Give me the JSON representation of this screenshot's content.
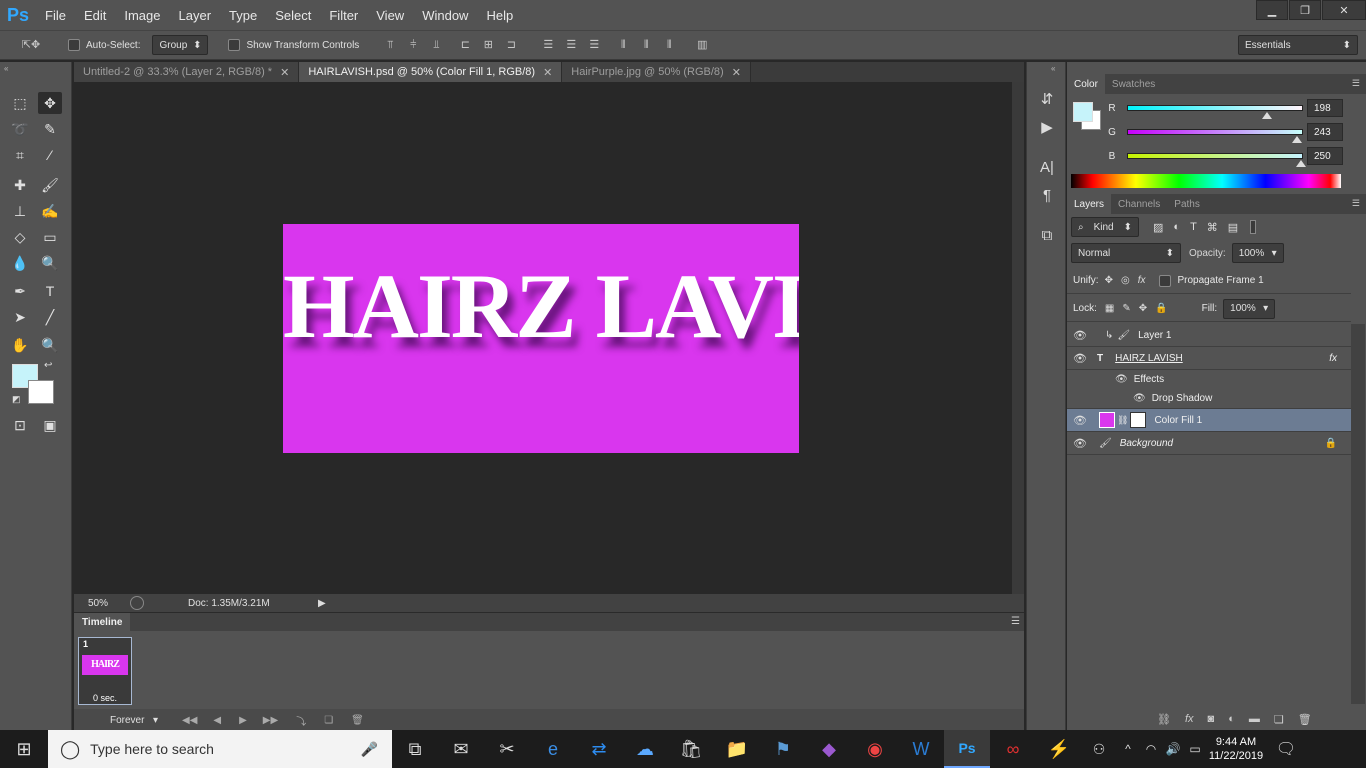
{
  "app": {
    "logo": "Ps"
  },
  "menu": [
    "File",
    "Edit",
    "Image",
    "Layer",
    "Type",
    "Select",
    "Filter",
    "View",
    "Window",
    "Help"
  ],
  "options": {
    "auto_select_label": "Auto-Select:",
    "auto_select_value": "Group",
    "transform_label": "Show Transform Controls",
    "workspace": "Essentials"
  },
  "tabs": [
    {
      "label": "Untitled-2 @ 33.3% (Layer 2, RGB/8) *"
    },
    {
      "label": "HAIRLAVISH.psd @ 50% (Color Fill 1, RGB/8)"
    },
    {
      "label": "HairPurple.jpg @ 50% (RGB/8)"
    }
  ],
  "document": {
    "text_part1": "HAIRZ",
    "text_part2": "LAVISH",
    "bg_color": "#d936ee"
  },
  "status": {
    "zoom": "50%",
    "doc": "Doc: 1.35M/3.21M"
  },
  "timeline": {
    "tab": "Timeline",
    "frame_number": "1",
    "frame_delay": "0 sec.",
    "thumb_text": "HAIRZ LAVISH",
    "loop": "Forever"
  },
  "color_panel": {
    "tabs": [
      "Color",
      "Swatches"
    ],
    "r_label": "R",
    "r_value": "198",
    "g_label": "G",
    "g_value": "243",
    "b_label": "B",
    "b_value": "250",
    "fg_color": "#c6f3fa"
  },
  "layers_panel": {
    "tabs": [
      "Layers",
      "Channels",
      "Paths"
    ],
    "kind": "Kind",
    "blend_mode": "Normal",
    "opacity_label": "Opacity:",
    "opacity_value": "100%",
    "unify_label": "Unify:",
    "propagate_label": "Propagate Frame 1",
    "lock_label": "Lock:",
    "fill_label": "Fill:",
    "fill_value": "100%",
    "layers": [
      {
        "name": "Layer 1"
      },
      {
        "name": "HAIRZ LAVISH"
      },
      {
        "name": "Effects"
      },
      {
        "name": "Drop Shadow"
      },
      {
        "name": "Color Fill 1"
      },
      {
        "name": "Background"
      }
    ]
  },
  "taskbar": {
    "search_placeholder": "Type here to search",
    "time": "9:44 AM",
    "date": "11/22/2019"
  }
}
